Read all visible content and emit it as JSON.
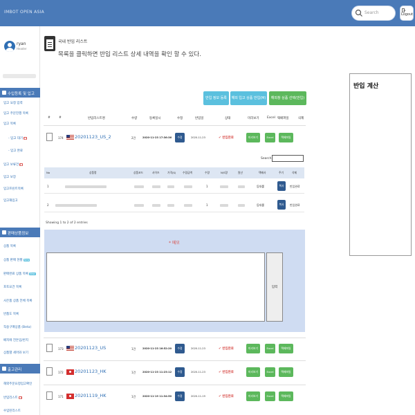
{
  "header": {
    "brand": "IMBOT OPEN ASIA",
    "search_placeholder": "Search",
    "logout_label": "Logout"
  },
  "user": {
    "name": "ryan",
    "role": "Header"
  },
  "sidebar": {
    "section1": "수입등록 및 입고",
    "items1": [
      {
        "label": "입고 요청 입력"
      },
      {
        "label": "입고 주문진행 목록"
      },
      {
        "label": "입고 목록"
      },
      {
        "label": "- 입고 대기",
        "badge": "●"
      },
      {
        "label": "- 입고 완료"
      },
      {
        "label": "입고 보류건",
        "badge": "●"
      },
      {
        "label": "입고 보장"
      },
      {
        "label": "입고프린트목록"
      },
      {
        "label": "입고재입고"
      }
    ],
    "section2": "판매상품정보",
    "items2": [
      {
        "label": "상품 목록"
      },
      {
        "label": "상품 판매 현황",
        "badge": "New"
      },
      {
        "label": "판매완료 상품 목록",
        "badge": "New"
      },
      {
        "label": "포토요건 목록"
      },
      {
        "label": "사은품 상품 전체 목록"
      },
      {
        "label": "반품도 목록"
      },
      {
        "label": "직송구매상품 (Beta)"
      },
      {
        "label": "배지에 전돈입/반지"
      },
      {
        "label": "상품별 세어와 보기"
      }
    ],
    "section3": "출고관리",
    "items3": [
      {
        "label": "해외주문요청입고확인"
      },
      {
        "label": "반입리스트",
        "badge": "●"
      },
      {
        "label": "수입된리스트"
      }
    ]
  },
  "page": {
    "title": "국내 반입 리스트",
    "description": "목록을 클릭하면 반입 리스트 상세 내역을 확인 할 수 있다."
  },
  "calc_panel": {
    "title": "반입 계산"
  },
  "actions": {
    "register": "반입 정보 등록",
    "overseas": "해외 입고 상품 반입(M)",
    "select": "해외창 상품 선택(반입)"
  },
  "table": {
    "headers": [
      "#",
      "#",
      "반입리스트명",
      "수량",
      "등록일시",
      "수정",
      "반입일",
      "상태",
      "미리보기",
      "Excel",
      "택배파일",
      "삭제"
    ],
    "rows": [
      {
        "no": "174",
        "flag": "us",
        "name": "20201123_US_2",
        "qty": "2건",
        "datetime": "2020-11-23 17:36:36",
        "edit": "수정",
        "date": "2020-11-23",
        "status": "✔ 반입완료",
        "preview": "미리보기",
        "excel": "Excel",
        "file": "택배파일"
      },
      {
        "no": "173",
        "flag": "us",
        "name": "20201123_US",
        "qty": "1건",
        "datetime": "2020-11-23 16:52:20",
        "edit": "수정",
        "date": "2020-11-23",
        "status": "✔ 반입완료",
        "preview": "미리보기",
        "excel": "Excel",
        "file": "택배파일"
      },
      {
        "no": "172",
        "flag": "hk",
        "name": "20201123_HK",
        "qty": "1건",
        "datetime": "2020-11-23 11:23:12",
        "edit": "수정",
        "date": "2020-11-23",
        "status": "✔ 반입완료",
        "preview": "미리보기",
        "excel": "Excel",
        "file": "택배파일"
      },
      {
        "no": "171",
        "flag": "hk",
        "name": "20201119_HK",
        "qty": "1건",
        "datetime": "2020-11-19 11:34:50",
        "edit": "수정",
        "date": "2020-11-19",
        "status": "✔ 반입완료",
        "preview": "미리보기",
        "excel": "Excel",
        "file": "택배파일"
      }
    ]
  },
  "detail": {
    "search_label": "Search:",
    "headers": [
      "No",
      "상품명",
      "상품코드",
      "사이즈",
      "가격($)",
      "수량금액",
      "수량",
      "N/S량",
      "원산",
      "택배사",
      "주기",
      "삭제"
    ],
    "rows": [
      {
        "no": "1",
        "qty": "1",
        "carrier": "등대롤",
        "btn": "복사",
        "status": "반입완료"
      },
      {
        "no": "2",
        "qty": "1",
        "carrier": "등대롤",
        "btn": "복사",
        "status": "반입완료"
      }
    ],
    "showing": "Showing 1 to 2 of 2 entries",
    "memo_label": "* 메모",
    "memo_button": "입력"
  }
}
